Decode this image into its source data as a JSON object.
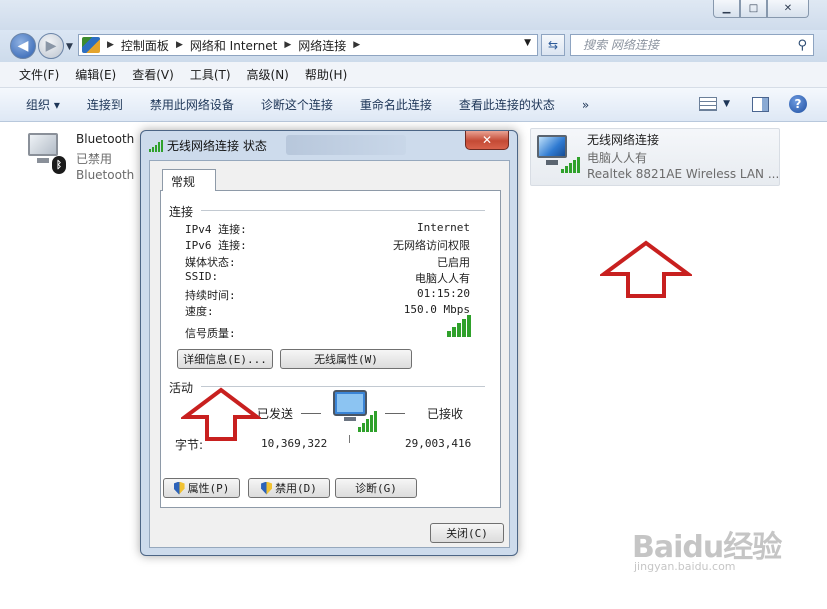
{
  "window": {
    "minimize_glyph": "▁",
    "maximize_glyph": "□",
    "close_glyph": "✕"
  },
  "navigation": {
    "breadcrumbs": [
      "控制面板",
      "网络和 Internet",
      "网络连接"
    ],
    "search_placeholder": "搜索 网络连接"
  },
  "menubar": {
    "items": [
      "文件(F)",
      "编辑(E)",
      "查看(V)",
      "工具(T)",
      "高级(N)",
      "帮助(H)"
    ]
  },
  "commandbar": {
    "organize": "组织 ▾",
    "items": [
      "连接到",
      "禁用此网络设备",
      "诊断这个连接",
      "重命名此连接",
      "查看此连接的状态"
    ],
    "more": "»"
  },
  "connections": {
    "bluetooth": {
      "name": "Bluetooth",
      "status": "已禁用",
      "device": "Bluetooth"
    },
    "wireless": {
      "name": "无线网络连接",
      "status": "电脑人人有",
      "device": "Realtek 8821AE Wireless LAN ..."
    }
  },
  "dialog": {
    "title": "无线网络连接 状态",
    "close_glyph": "✕",
    "tab": "常规",
    "connection_section": "连接",
    "connection_rows": [
      {
        "label": "IPv4 连接:",
        "value": "Internet"
      },
      {
        "label": "IPv6 连接:",
        "value": "无网络访问权限"
      },
      {
        "label": "媒体状态:",
        "value": "已启用"
      },
      {
        "label": "SSID:",
        "value": "电脑人人有"
      },
      {
        "label": "持续时间:",
        "value": "01:15:20"
      },
      {
        "label": "速度:",
        "value": "150.0 Mbps"
      }
    ],
    "signal_label": "信号质量:",
    "signal_level_bars": 5,
    "details_button": "详细信息(E)...",
    "wireless_props_button": "无线属性(W)",
    "activity_section": "活动",
    "sent_label": "已发送",
    "received_label": "已接收",
    "bytes_label": "字节:",
    "bytes_sent": "10,369,322",
    "bytes_received": "29,003,416",
    "properties_button": "属性(P)",
    "disable_button": "禁用(D)",
    "diagnose_button": "诊断(G)",
    "close_button": "关闭(C)"
  },
  "watermark": {
    "logo": "Baidu经验",
    "url": "jingyan.baidu.com"
  },
  "colors": {
    "arrow": "#c8201f",
    "signal": "#2fa12b"
  }
}
